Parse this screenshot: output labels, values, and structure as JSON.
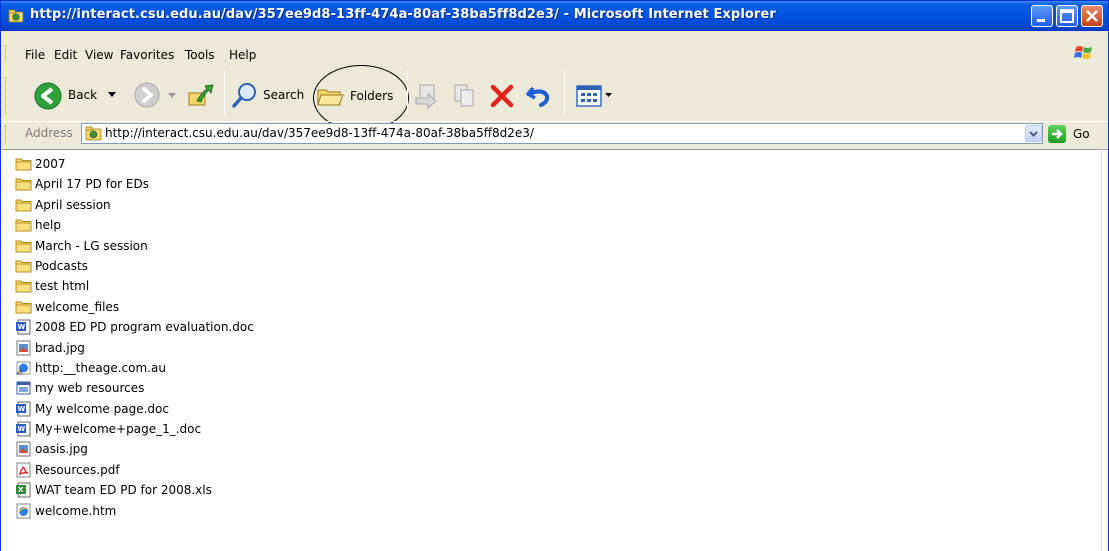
{
  "window": {
    "title": "http://interact.csu.edu.au/dav/357ee9d8-13ff-474a-80af-38ba5ff8d2e3/ - Microsoft Internet Explorer"
  },
  "menu": {
    "items": [
      "File",
      "Edit",
      "View",
      "Favorites",
      "Tools",
      "Help"
    ]
  },
  "toolbar": {
    "back_label": "Back",
    "search_label": "Search",
    "folders_label": "Folders"
  },
  "address": {
    "label": "Address",
    "url": "http://interact.csu.edu.au/dav/357ee9d8-13ff-474a-80af-38ba5ff8d2e3/",
    "go_label": "Go"
  },
  "files": [
    {
      "name": "2007",
      "icon": "folder-icon"
    },
    {
      "name": "April 17 PD for EDs",
      "icon": "folder-icon"
    },
    {
      "name": "April session",
      "icon": "folder-icon"
    },
    {
      "name": "help",
      "icon": "folder-icon"
    },
    {
      "name": "March - LG session",
      "icon": "folder-icon"
    },
    {
      "name": "Podcasts",
      "icon": "folder-icon"
    },
    {
      "name": "test html",
      "icon": "folder-icon"
    },
    {
      "name": "welcome_files",
      "icon": "folder-icon"
    },
    {
      "name": "2008 ED PD program evaluation.doc",
      "icon": "word-doc-icon"
    },
    {
      "name": "brad.jpg",
      "icon": "jpeg-image-icon"
    },
    {
      "name": "http:__theage.com.au",
      "icon": "internet-shortcut-icon"
    },
    {
      "name": "my web resources",
      "icon": "web-archive-icon"
    },
    {
      "name": "My welcome page.doc",
      "icon": "word-doc-icon"
    },
    {
      "name": "My+welcome+page_1_.doc",
      "icon": "word-doc-icon"
    },
    {
      "name": "oasis.jpg",
      "icon": "jpeg-image-icon"
    },
    {
      "name": "Resources.pdf",
      "icon": "pdf-icon"
    },
    {
      "name": "WAT team ED PD for 2008.xls",
      "icon": "excel-xls-icon"
    },
    {
      "name": "welcome.htm",
      "icon": "ie-html-icon"
    }
  ],
  "colors": {
    "titlebar": "#0053e0",
    "chrome": "#ece9d8",
    "folder": "#f5d66a"
  }
}
